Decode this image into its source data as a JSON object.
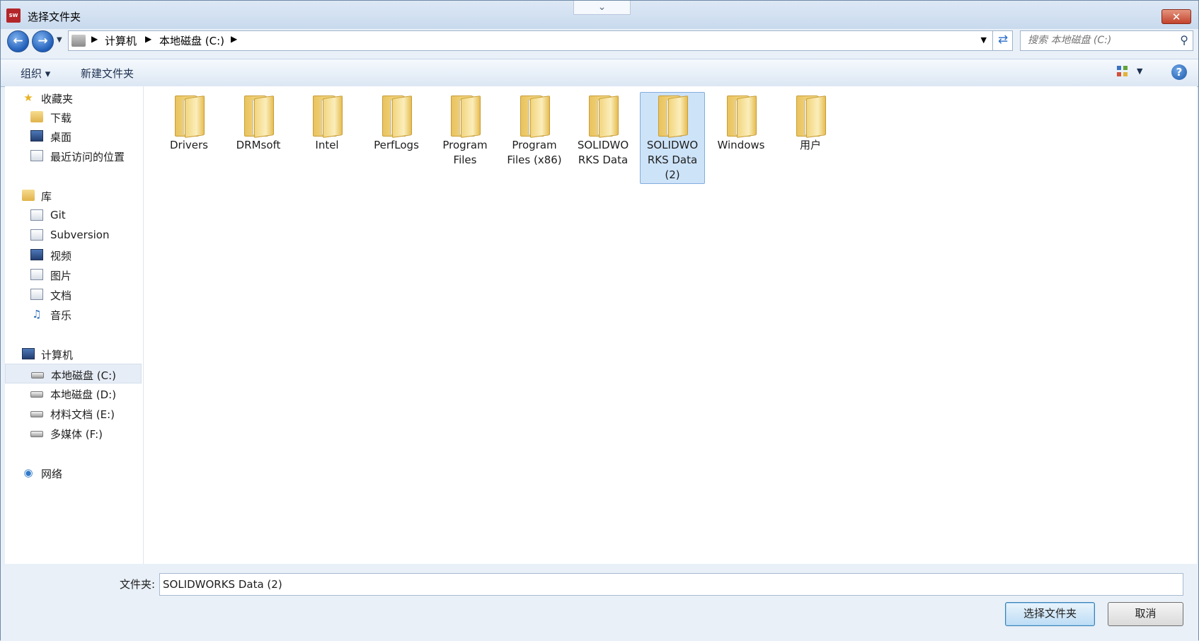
{
  "window": {
    "title": "选择文件夹",
    "app_icon": "solidworks-2018-icon",
    "close_symbol": "✕"
  },
  "address": {
    "path": [
      "计算机",
      "本地磁盘 (C:)"
    ]
  },
  "search": {
    "placeholder": "搜索 本地磁盘 (C:)"
  },
  "toolbar": {
    "organize_label": "组织 ▾",
    "new_folder_label": "新建文件夹"
  },
  "sidebar": {
    "favorites": {
      "header": "收藏夹",
      "items": [
        "下载",
        "桌面",
        "最近访问的位置"
      ]
    },
    "libraries": {
      "header": "库",
      "items": [
        "Git",
        "Subversion",
        "视频",
        "图片",
        "文档",
        "音乐"
      ]
    },
    "computer": {
      "header": "计算机",
      "items": [
        "本地磁盘 (C:)",
        "本地磁盘 (D:)",
        "材料文档 (E:)",
        "多媒体 (F:)"
      ],
      "selected": "本地磁盘 (C:)"
    },
    "network": {
      "header": "网络"
    }
  },
  "files": [
    {
      "name": "Drivers",
      "line1": "Drivers",
      "line2": "",
      "line3": ""
    },
    {
      "name": "DRMsoft",
      "line1": "DRMsoft",
      "line2": "",
      "line3": ""
    },
    {
      "name": "Intel",
      "line1": "Intel",
      "line2": "",
      "line3": ""
    },
    {
      "name": "PerfLogs",
      "line1": "PerfLogs",
      "line2": "",
      "line3": ""
    },
    {
      "name": "Program Files",
      "line1": "Program",
      "line2": "Files",
      "line3": ""
    },
    {
      "name": "Program Files (x86)",
      "line1": "Program",
      "line2": "Files (x86)",
      "line3": ""
    },
    {
      "name": "SOLIDWORKS Data",
      "line1": "SOLIDWO",
      "line2": "RKS Data",
      "line3": ""
    },
    {
      "name": "SOLIDWORKS Data (2)",
      "line1": "SOLIDWO",
      "line2": "RKS Data",
      "line3": "(2)"
    },
    {
      "name": "Windows",
      "line1": "Windows",
      "line2": "",
      "line3": ""
    },
    {
      "name": "用户",
      "line1": "用户",
      "line2": "",
      "line3": ""
    }
  ],
  "selected_file": "SOLIDWORKS Data (2)",
  "footer": {
    "folder_label": "文件夹:",
    "folder_value": "SOLIDWORKS Data (2)",
    "ok_label": "选择文件夹",
    "cancel_label": "取消"
  },
  "colors": {
    "selection_bg": "#cde3f8",
    "selection_border": "#84acdd",
    "close_button": "#c3432c"
  }
}
